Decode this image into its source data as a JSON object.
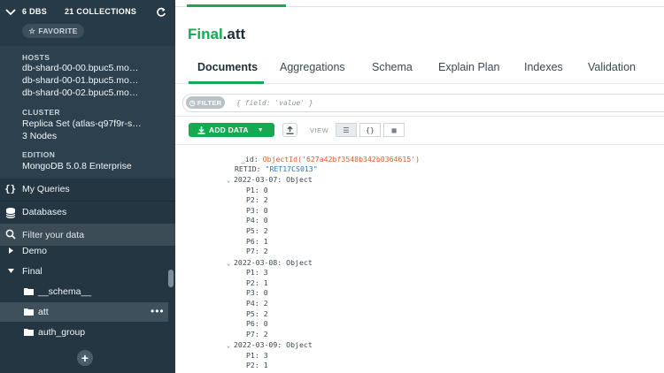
{
  "sidebar": {
    "dbs_count": "6 DBS",
    "collections_count": "21 COLLECTIONS",
    "favorite_label": "FAVORITE",
    "hosts_label": "HOSTS",
    "hosts": [
      "db-shard-00-00.bpuc5.mo…",
      "db-shard-00-01.bpuc5.mo…",
      "db-shard-00-02.bpuc5.mo…"
    ],
    "cluster_label": "CLUSTER",
    "cluster_value": "Replica Set (atlas-q97f9r-s…",
    "cluster_nodes": "3 Nodes",
    "edition_label": "EDITION",
    "edition_value": "MongoDB 5.0.8 Enterprise",
    "my_queries": "My Queries",
    "databases": "Databases",
    "filter_placeholder": "Filter your data",
    "tree": {
      "demo": "Demo",
      "final": "Final",
      "schema": "__schema__",
      "att": "att",
      "auth_group": "auth_group"
    },
    "add_button": "+"
  },
  "main": {
    "db_name": "Final",
    "coll_name": ".att",
    "tabs": [
      "Documents",
      "Aggregations",
      "Schema",
      "Explain Plan",
      "Indexes",
      "Validation"
    ],
    "filter_label": "FILTER",
    "filter_placeholder": "{ field: 'value' }",
    "add_data_label": "ADD DATA",
    "view_label": "VIEW",
    "view_buttons": [
      "☰",
      "{}",
      "▦"
    ]
  },
  "document": {
    "id_key": "_id:",
    "id_value": "ObjectId('627a42bf3548b342b0364615')",
    "retid_key": "RETID:",
    "retid_value": "\"RET17CS013\"",
    "groups": [
      {
        "key": "2022-03-07:",
        "type": "Object",
        "fields": [
          [
            "P1:",
            "0"
          ],
          [
            "P2:",
            "2"
          ],
          [
            "P3:",
            "0"
          ],
          [
            "P4:",
            "0"
          ],
          [
            "P5:",
            "2"
          ],
          [
            "P6:",
            "1"
          ],
          [
            "P7:",
            "2"
          ]
        ]
      },
      {
        "key": "2022-03-08:",
        "type": "Object",
        "fields": [
          [
            "P1:",
            "3"
          ],
          [
            "P2:",
            "1"
          ],
          [
            "P3:",
            "0"
          ],
          [
            "P4:",
            "2"
          ],
          [
            "P5:",
            "2"
          ],
          [
            "P6:",
            "0"
          ],
          [
            "P7:",
            "2"
          ]
        ]
      },
      {
        "key": "2022-03-09:",
        "type": "Object",
        "fields": [
          [
            "P1:",
            "3"
          ],
          [
            "P2:",
            "1"
          ]
        ]
      }
    ]
  },
  "colors": {
    "accent": "#13aa52",
    "sidebar_bg": "#243642",
    "object_id": "#e25b2c",
    "string": "#2b77c1"
  }
}
